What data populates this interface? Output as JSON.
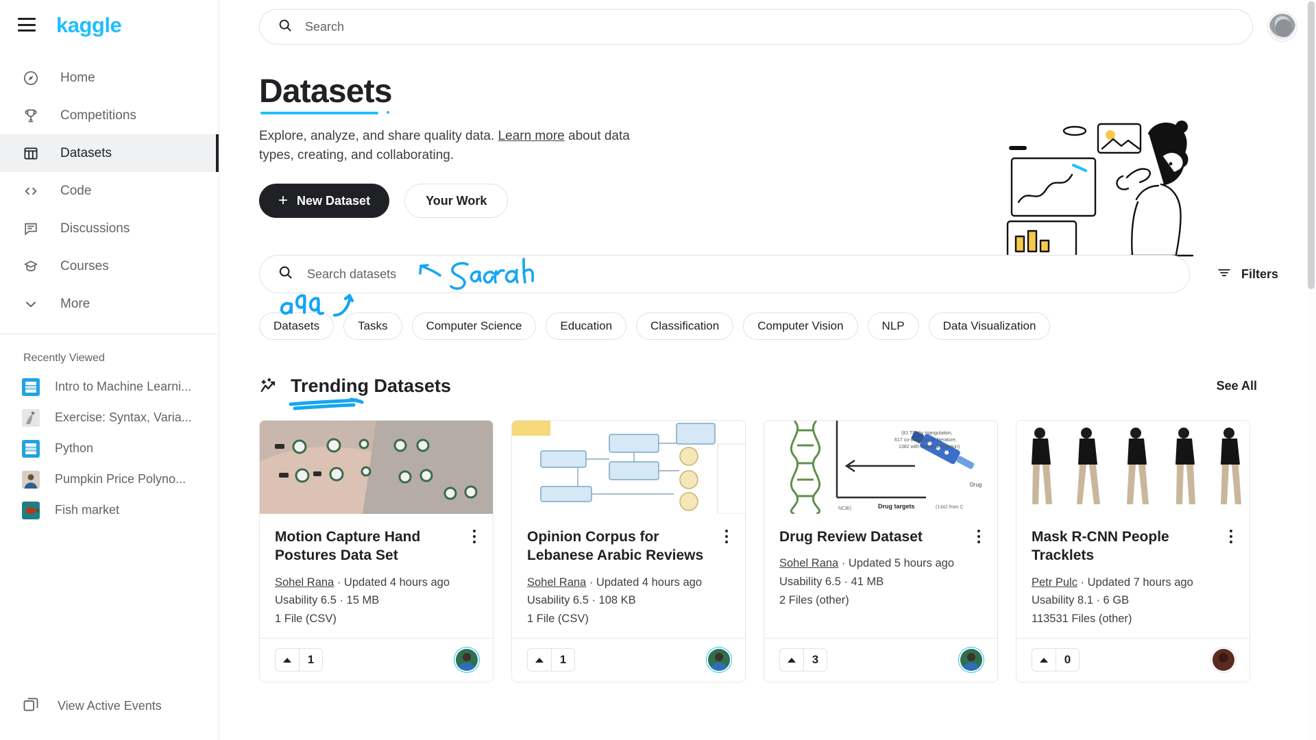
{
  "brand": {
    "logo_text": "kaggle",
    "accent_color": "#20BEFF",
    "dark_color": "#202124"
  },
  "sidebar": {
    "nav_items": [
      {
        "label": "Home",
        "icon": "compass-icon",
        "active": false
      },
      {
        "label": "Competitions",
        "icon": "trophy-icon",
        "active": false
      },
      {
        "label": "Datasets",
        "icon": "table-icon",
        "active": true
      },
      {
        "label": "Code",
        "icon": "code-brackets-icon",
        "active": false
      },
      {
        "label": "Discussions",
        "icon": "comment-icon",
        "active": false
      },
      {
        "label": "Courses",
        "icon": "graduation-cap-icon",
        "active": false
      },
      {
        "label": "More",
        "icon": "chevron-down-icon",
        "active": false
      }
    ],
    "recently_viewed_title": "Recently Viewed",
    "recently_viewed": [
      {
        "label": "Intro to Machine Learni...",
        "thumb": "course-blue"
      },
      {
        "label": "Exercise: Syntax, Varia...",
        "thumb": "gray-photo"
      },
      {
        "label": "Python",
        "thumb": "course-blue"
      },
      {
        "label": "Pumpkin Price Polyno...",
        "thumb": "person-photo"
      },
      {
        "label": "Fish market",
        "thumb": "fish-photo"
      }
    ],
    "footer_link": "View Active Events"
  },
  "topbar": {
    "search_placeholder": "Search",
    "search_value": "",
    "avatar": "user-avatar"
  },
  "hero": {
    "title": "Datasets",
    "subtitle_before": "Explore, analyze, and share quality data. ",
    "subtitle_link": "Learn more",
    "subtitle_after": " about data types, creating, and collaborating.",
    "primary_button": "New Dataset",
    "secondary_button": "Your Work"
  },
  "annotations": [
    {
      "text": "add",
      "color": "#20BEFF",
      "points_to": "new-dataset-button"
    },
    {
      "text": "Search",
      "color": "#20BEFF",
      "points_to": "dataset-search-input"
    },
    {
      "text": "",
      "color": "#20BEFF",
      "points_to": "trending-datasets-underline"
    }
  ],
  "dataset_search": {
    "placeholder": "Search datasets",
    "value": "",
    "filters_label": "Filters"
  },
  "chips": [
    "Datasets",
    "Tasks",
    "Computer Science",
    "Education",
    "Classification",
    "Computer Vision",
    "NLP",
    "Data Visualization"
  ],
  "trending": {
    "section_title": "Trending Datasets",
    "see_all": "See All",
    "cards": [
      {
        "title": "Motion Capture Hand Postures Data Set",
        "owner": "Sohel Rana",
        "updated": "Updated 4 hours ago",
        "usability": "Usability 6.5 · 15 MB",
        "files": "1 File (CSV)",
        "votes": "1",
        "thumb": "hands-motion-capture"
      },
      {
        "title": "Opinion Corpus for Lebanese Arabic Reviews",
        "owner": "Sohel Rana",
        "updated": "Updated 4 hours ago",
        "usability": "Usability 6.5 · 108 KB",
        "files": "1 File (CSV)",
        "votes": "1",
        "thumb": "flowchart-diagram"
      },
      {
        "title": "Drug Review Dataset",
        "owner": "Sohel Rana",
        "updated": "Updated 5 hours ago",
        "usability": "Usability 6.5 · 41 MB",
        "files": "2 Files (other)",
        "votes": "3",
        "thumb": "dna-syringe-diagram"
      },
      {
        "title": "Mask R-CNN People Tracklets",
        "owner": "Petr Pulc",
        "updated": "Updated 7 hours ago",
        "usability": "Usability 8.1 · 6 GB",
        "files": "113531 Files (other)",
        "votes": "0",
        "thumb": "walking-people-sprites"
      }
    ]
  }
}
